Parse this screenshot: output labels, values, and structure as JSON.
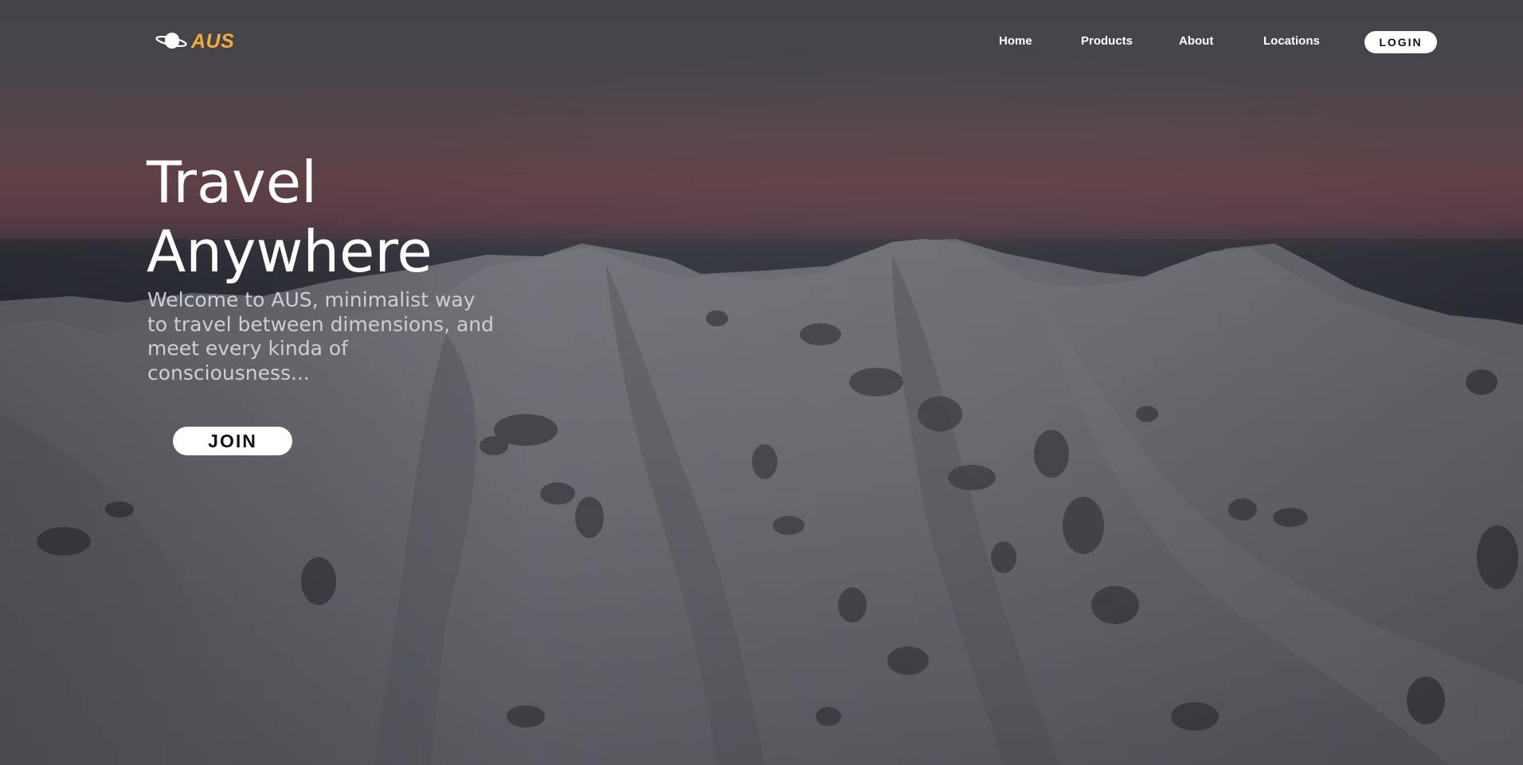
{
  "brand": {
    "name": "AUS",
    "icon": "planet-icon",
    "color": "#f0ad2f"
  },
  "nav": {
    "items": [
      {
        "label": "Home"
      },
      {
        "label": "Products"
      },
      {
        "label": "About"
      },
      {
        "label": "Locations"
      }
    ],
    "login_label": "LOGIN"
  },
  "hero": {
    "title_line1": "Travel",
    "title_line2": "Anywhere",
    "subtitle": "Welcome to AUS, minimalist way to travel between dimensions, and meet every kinda of consciousness...",
    "join_label": "JOIN"
  },
  "background": {
    "description_colors": {
      "sky_top": "#515157",
      "sky_glow": "#7a4a4f",
      "horizon": "#3a3f4c",
      "snow_light": "#bfc0c8",
      "snow_dark": "#6c6d76",
      "overlay": "#2b2b30"
    }
  }
}
